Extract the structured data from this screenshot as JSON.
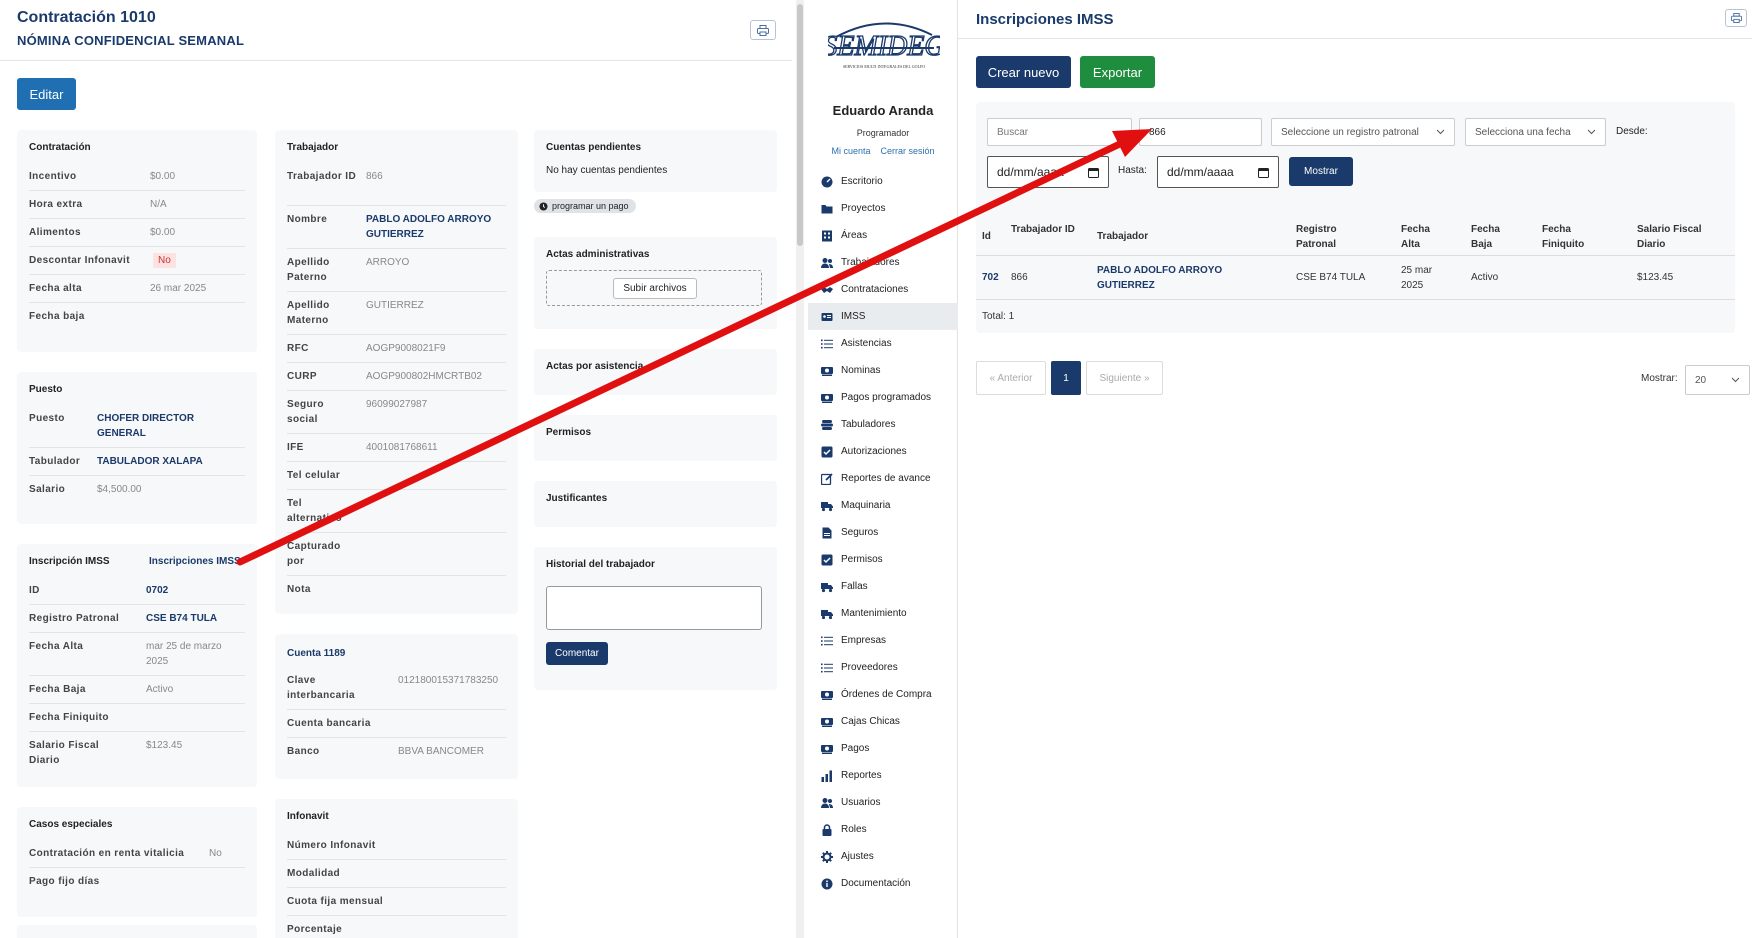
{
  "left": {
    "title": "Contratación 1010",
    "subtitle": "NÓMINA CONFIDENCIAL SEMANAL",
    "edit_label": "Editar",
    "contratacion": {
      "title": "Contratación",
      "rows": [
        {
          "label": "Incentivo",
          "value": "$0.00"
        },
        {
          "label": "Hora extra",
          "value": "N/A"
        },
        {
          "label": "Alimentos",
          "value": "$0.00"
        },
        {
          "label": "Descontar Infonavit",
          "value": "No"
        },
        {
          "label": "Fecha alta",
          "value": "26 mar 2025"
        },
        {
          "label": "Fecha baja",
          "value": ""
        }
      ]
    },
    "puesto": {
      "title": "Puesto",
      "rows": [
        {
          "label": "Puesto",
          "value": "CHOFER DIRECTOR GENERAL"
        },
        {
          "label": "Tabulador",
          "value": "TABULADOR XALAPA"
        },
        {
          "label": "Salario",
          "value": "$4,500.00"
        }
      ]
    },
    "imss": {
      "title": "Inscripción IMSS",
      "link": "Inscripciones IMSS",
      "rows": [
        {
          "label": "ID",
          "value": "0702"
        },
        {
          "label": "Registro Patronal",
          "value": "CSE B74 TULA"
        },
        {
          "label": "Fecha Alta",
          "value": "mar 25 de marzo 2025"
        },
        {
          "label": "Fecha Baja",
          "value": "Activo"
        },
        {
          "label": "Fecha Finiquito",
          "value": ""
        },
        {
          "label": "Salario Fiscal Diario",
          "value": "$123.45"
        }
      ]
    },
    "casos": {
      "title": "Casos especiales",
      "rows": [
        {
          "label": "Contratación en renta vitalicia",
          "value": "No"
        },
        {
          "label": "Pago fijo días",
          "value": ""
        }
      ]
    },
    "trabajador": {
      "title": "Trabajador",
      "rows": [
        {
          "label": "Trabajador ID",
          "value": "866"
        },
        {
          "label": "Nombre",
          "value": "PABLO ADOLFO ARROYO GUTIERREZ"
        },
        {
          "label": "Apellido Paterno",
          "value": "ARROYO"
        },
        {
          "label": "Apellido Materno",
          "value": "GUTIERREZ"
        },
        {
          "label": "RFC",
          "value": "AOGP9008021F9"
        },
        {
          "label": "CURP",
          "value": "AOGP900802HMCRTB02"
        },
        {
          "label": "Seguro social",
          "value": "96099027987"
        },
        {
          "label": "IFE",
          "value": "4001081768611"
        },
        {
          "label": "Tel celular",
          "value": ""
        },
        {
          "label": "Tel alternativo",
          "value": ""
        },
        {
          "label": "Capturado por",
          "value": ""
        },
        {
          "label": "Nota",
          "value": ""
        }
      ]
    },
    "cuenta": {
      "title": "Cuenta 1189",
      "rows": [
        {
          "label": "Clave interbancaria",
          "value": "012180015371783250"
        },
        {
          "label": "Cuenta bancaria",
          "value": ""
        },
        {
          "label": "Banco",
          "value": "BBVA BANCOMER"
        }
      ]
    },
    "infonavit": {
      "title": "Infonavit",
      "rows": [
        {
          "label": "Número Infonavit",
          "value": ""
        },
        {
          "label": "Modalidad",
          "value": ""
        },
        {
          "label": "Cuota fija mensual",
          "value": ""
        },
        {
          "label": "Porcentaje",
          "value": ""
        }
      ]
    },
    "cuentas_pendientes": {
      "title": "Cuentas pendientes",
      "text": "No hay cuentas pendientes",
      "badge": "programar un pago"
    },
    "actas_admin": {
      "title": "Actas administrativas",
      "upload_label": "Subir archivos"
    },
    "actas_asistencia": {
      "title": "Actas por asistencia"
    },
    "permisos": {
      "title": "Permisos"
    },
    "justificantes": {
      "title": "Justificantes"
    },
    "historial": {
      "title": "Historial del trabajador",
      "comment_label": "Comentar"
    }
  },
  "sidebar": {
    "logo_text": "SEMIDEG",
    "logo_sub": "SERVICIOS MULTI INTEGRALES DEL GOLFO",
    "user_name": "Eduardo Aranda",
    "user_role": "Programador",
    "my_account": "Mi cuenta",
    "logout": "Cerrar sesión",
    "items": [
      {
        "label": "Escritorio",
        "icon": "dashboard-icon"
      },
      {
        "label": "Proyectos",
        "icon": "folder-icon"
      },
      {
        "label": "Áreas",
        "icon": "building-icon"
      },
      {
        "label": "Trabajadores",
        "icon": "users-icon"
      },
      {
        "label": "Contrataciones",
        "icon": "handshake-icon"
      },
      {
        "label": "IMSS",
        "icon": "id-card-icon"
      },
      {
        "label": "Asistencias",
        "icon": "list-icon"
      },
      {
        "label": "Nominas",
        "icon": "money-icon"
      },
      {
        "label": "Pagos programados",
        "icon": "money-icon"
      },
      {
        "label": "Tabuladores",
        "icon": "stack-icon"
      },
      {
        "label": "Autorizaciones",
        "icon": "check-square-icon"
      },
      {
        "label": "Reportes de avance",
        "icon": "edit-icon"
      },
      {
        "label": "Maquinaria",
        "icon": "truck-icon"
      },
      {
        "label": "Seguros",
        "icon": "file-icon"
      },
      {
        "label": "Permisos",
        "icon": "check-square-icon"
      },
      {
        "label": "Fallas",
        "icon": "truck-icon"
      },
      {
        "label": "Mantenimiento",
        "icon": "truck-icon"
      },
      {
        "label": "Empresas",
        "icon": "list-icon"
      },
      {
        "label": "Proveedores",
        "icon": "list-icon"
      },
      {
        "label": "Órdenes de Compra",
        "icon": "money-icon"
      },
      {
        "label": "Cajas Chicas",
        "icon": "money-icon"
      },
      {
        "label": "Pagos",
        "icon": "money-icon"
      },
      {
        "label": "Reportes",
        "icon": "bar-chart-icon"
      },
      {
        "label": "Usuarios",
        "icon": "users-icon"
      },
      {
        "label": "Roles",
        "icon": "lock-icon"
      },
      {
        "label": "Ajustes",
        "icon": "gear-icon"
      },
      {
        "label": "Documentación",
        "icon": "info-icon"
      }
    ],
    "active_index": 5
  },
  "main": {
    "title": "Inscripciones IMSS",
    "create_label": "Crear nuevo",
    "export_label": "Exportar",
    "search_placeholder": "Buscar",
    "worker_filter_value": "866",
    "registro_placeholder": "Seleccione un registro patronal",
    "date_select": "Selecciona una fecha",
    "desde_label": "Desde:",
    "hasta_label": "Hasta:",
    "date_placeholder": "dd/mm/aaaa",
    "show_label": "Mostrar",
    "table": {
      "headers": [
        "Id",
        "Trabajador ID",
        "Trabajador",
        "Registro Patronal",
        "Fecha Alta",
        "Fecha Baja",
        "Fecha Finiquito",
        "Salario Fiscal Diario"
      ],
      "rows": [
        [
          "702",
          "866",
          "PABLO ADOLFO ARROYO GUTIERREZ",
          "CSE B74 TULA",
          "25 mar 2025",
          "Activo",
          "",
          "$123.45"
        ]
      ]
    },
    "total_text": "Total: 1",
    "pagination": {
      "prev": "« Anterior",
      "current": "1",
      "next": "Siguiente »"
    },
    "per_page_label": "Mostrar:",
    "per_page_value": "20"
  },
  "colors": {
    "navy": "#1a3a6b",
    "edit_blue": "#1f6fb2",
    "export_green": "#1e8e3e",
    "annotation_red": "#e11010"
  }
}
